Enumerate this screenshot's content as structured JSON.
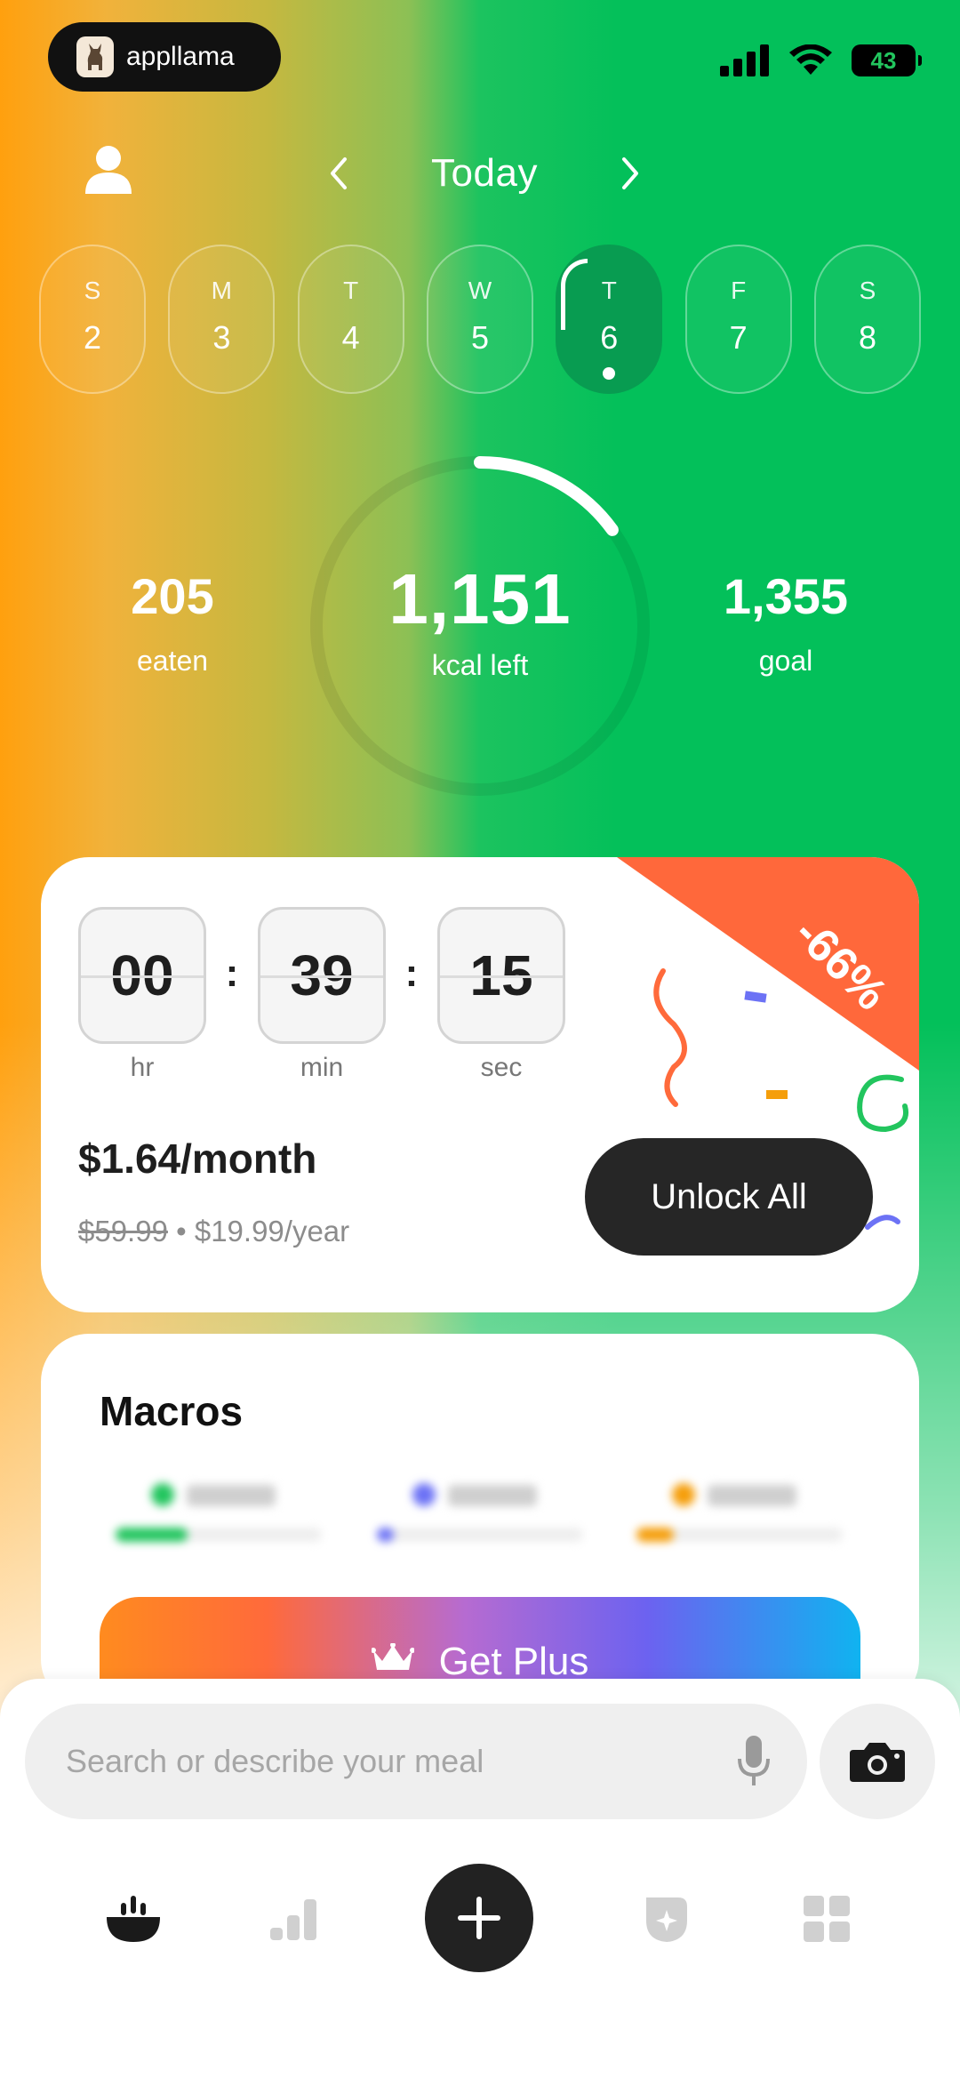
{
  "colors": {
    "accent_green": "#03c05a",
    "accent_orange": "#ffa00e",
    "active_day": "#089c51",
    "discount_ribbon": "#ff683b",
    "dark_button": "#262626"
  },
  "status_bar": {
    "app_badge": "appllama",
    "battery": "43"
  },
  "header": {
    "title": "Today",
    "profile_icon": "user-icon",
    "prev_icon": "chevron-left-icon",
    "next_icon": "chevron-right-icon"
  },
  "week": [
    {
      "dow": "S",
      "date": "2"
    },
    {
      "dow": "M",
      "date": "3"
    },
    {
      "dow": "T",
      "date": "4"
    },
    {
      "dow": "W",
      "date": "5"
    },
    {
      "dow": "T",
      "date": "6",
      "selected": true
    },
    {
      "dow": "F",
      "date": "7"
    },
    {
      "dow": "S",
      "date": "8"
    }
  ],
  "calories": {
    "eaten_value": "205",
    "eaten_label": "eaten",
    "left_value": "1,151",
    "left_label": "kcal left",
    "goal_value": "1,355",
    "goal_label": "goal",
    "ring_progress": 0.15
  },
  "promo": {
    "timer": {
      "hr": "00",
      "min": "39",
      "sec": "15",
      "hr_label": "hr",
      "min_label": "min",
      "sec_label": "sec",
      "sep": ":"
    },
    "price": "$1.64/month",
    "old_price": "$59.99",
    "dot": "•",
    "yearly_price": "$19.99/year",
    "cta": "Unlock All",
    "discount": "-66%"
  },
  "macros": {
    "title": "Macros",
    "items": [
      {
        "color": "#22c55e",
        "fill": 0.35
      },
      {
        "color": "#6c72f5",
        "fill": 0.08
      },
      {
        "color": "#f59e0b",
        "fill": 0.18
      }
    ],
    "get_plus_label": "Get Plus",
    "get_plus_icon": "crown-icon"
  },
  "search": {
    "placeholder": "Search or describe your meal",
    "mic_icon": "microphone-icon",
    "camera_icon": "camera-icon"
  },
  "tabbar": [
    {
      "name": "bowl-icon",
      "active": true
    },
    {
      "name": "bar-chart-icon",
      "active": false
    },
    {
      "name": "plus-icon",
      "active": false
    },
    {
      "name": "badge-sparkle-icon",
      "active": false
    },
    {
      "name": "grid-icon",
      "active": false
    }
  ]
}
